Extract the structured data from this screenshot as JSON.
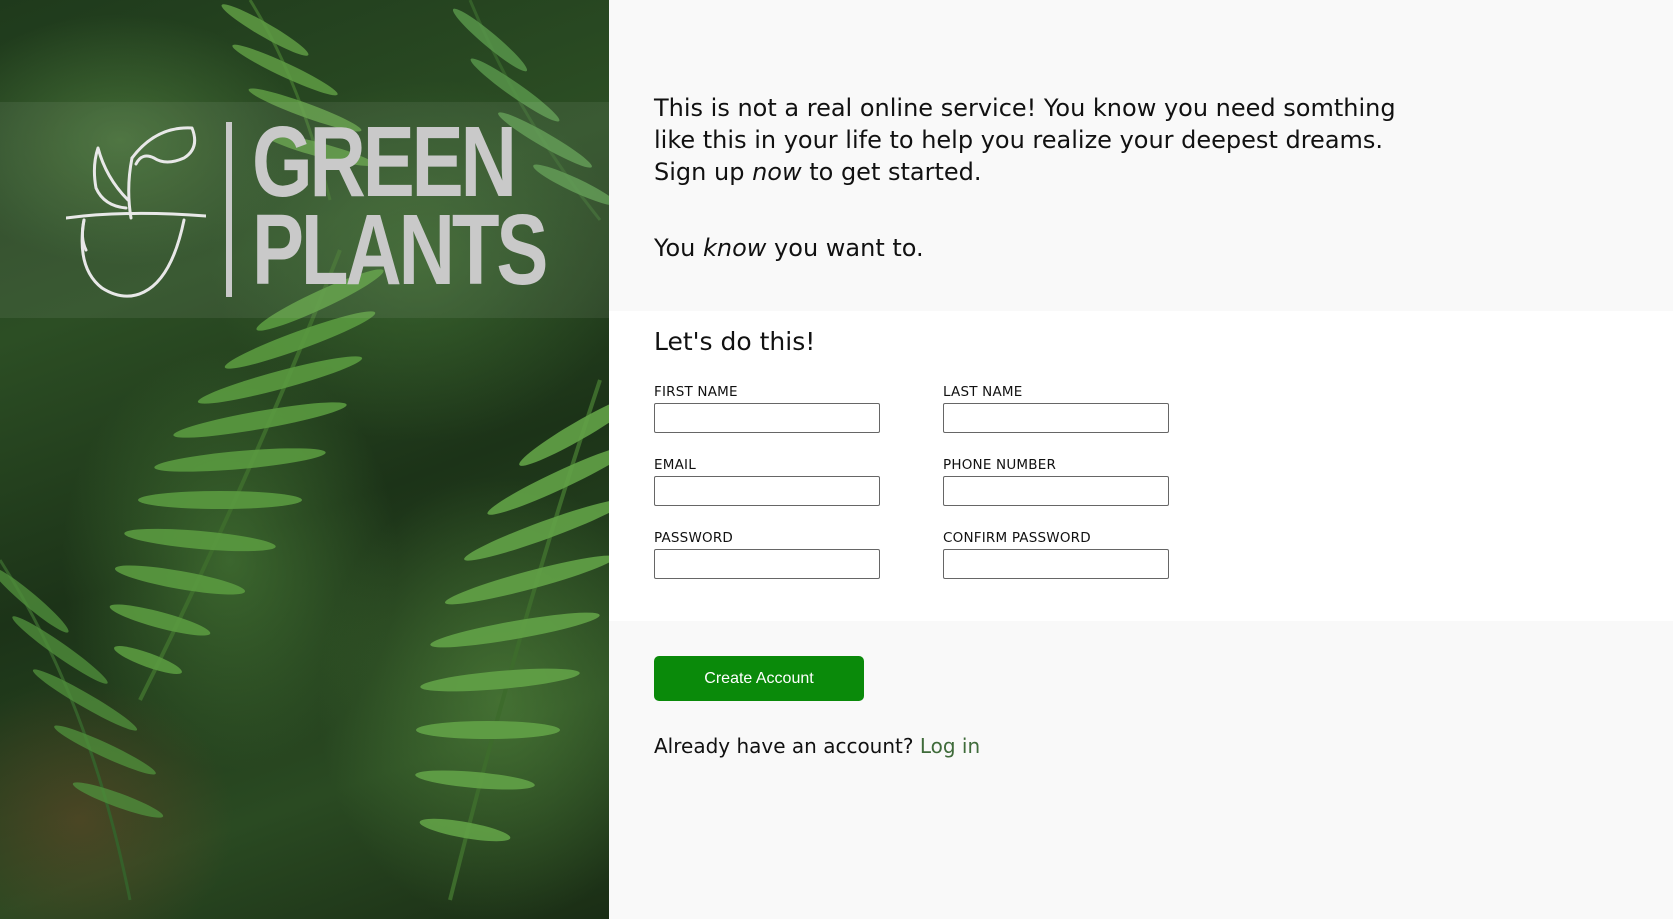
{
  "brand": {
    "line1": "GREEN",
    "line2": "PLANTS"
  },
  "intro": {
    "paragraph_before": "This is not a real online service! You know you need somthing like this in your life to help you realize your deepest dreams. Sign up ",
    "paragraph_emphasis": "now",
    "paragraph_after": " to get started.",
    "tagline_before": "You ",
    "tagline_emphasis": "know",
    "tagline_after": " you want to."
  },
  "form": {
    "title": "Let's do this!",
    "fields": {
      "first_name": {
        "label": "FIRST NAME",
        "value": ""
      },
      "last_name": {
        "label": "LAST NAME",
        "value": ""
      },
      "email": {
        "label": "EMAIL",
        "value": ""
      },
      "phone": {
        "label": "PHONE NUMBER",
        "value": ""
      },
      "password": {
        "label": "PASSWORD",
        "value": ""
      },
      "confirm_password": {
        "label": "CONFIRM PASSWORD",
        "value": ""
      }
    }
  },
  "actions": {
    "create_account_label": "Create Account",
    "login_prompt": "Already have an account?",
    "login_link_label": "Log in"
  },
  "colors": {
    "button": "#0a8a0a",
    "link": "#3f6b3a",
    "page_background": "#f9f9f9",
    "form_background": "#ffffff"
  },
  "icons": {
    "logo_icon": "plant-pot-icon"
  }
}
